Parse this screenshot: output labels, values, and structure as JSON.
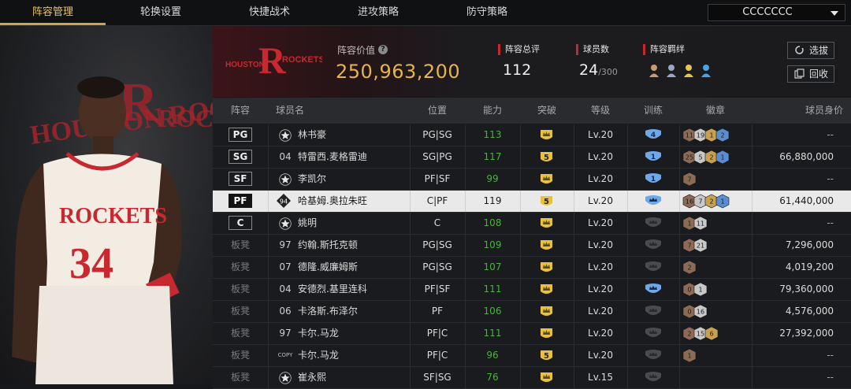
{
  "nav": {
    "tabs": [
      "阵容管理",
      "轮换设置",
      "快捷战术",
      "进攻策略",
      "防守策略"
    ],
    "team_select": "CCCCCCC"
  },
  "header": {
    "logo_text_left": "HOUSTON",
    "logo_text_right": "ROCKETS",
    "lineup_value_label": "阵容价值",
    "lineup_value": "250,963,200",
    "total_rating_label": "阵容总评",
    "total_rating": "112",
    "player_count_label": "球员数",
    "player_count": "24",
    "player_count_max": "/300",
    "bond_label": "阵容羁绊",
    "select_button": "选拔",
    "recycle_button": "回收"
  },
  "table": {
    "headers": [
      "阵容",
      "球员名",
      "位置",
      "能力",
      "突破",
      "等级",
      "训练",
      "徽章",
      "球员身价"
    ],
    "rows": [
      {
        "slot": "PG",
        "num": "",
        "name": "林书豪",
        "pos": "PG|SG",
        "ability": "113",
        "break": "",
        "level": "Lv.20",
        "train": "4",
        "badges": [
          "11",
          "19",
          "1",
          "2"
        ],
        "value": "--"
      },
      {
        "slot": "SG",
        "num": "04",
        "name": "特雷西.麦格雷迪",
        "pos": "SG|PG",
        "ability": "117",
        "break": "5",
        "level": "Lv.20",
        "train": "1",
        "badges": [
          "25",
          "5",
          "2",
          "1"
        ],
        "value": "66,880,000"
      },
      {
        "slot": "SF",
        "num": "",
        "name": "李凯尔",
        "pos": "PF|SF",
        "ability": "99",
        "break": "",
        "level": "Lv.20",
        "train": "1",
        "badges": [
          "7"
        ],
        "value": "--"
      },
      {
        "slot": "PF",
        "num": "94",
        "name": "哈基姆.奥拉朱旺",
        "pos": "C|PF",
        "ability": "119",
        "break": "5",
        "level": "Lv.20",
        "train": "",
        "badges": [
          "16",
          "7",
          "2",
          "1"
        ],
        "value": "61,440,000"
      },
      {
        "slot": "C",
        "num": "",
        "name": "姚明",
        "pos": "C",
        "ability": "108",
        "break": "",
        "level": "Lv.20",
        "train": "",
        "badges": [
          "1",
          "11"
        ],
        "value": "--"
      },
      {
        "slot": "板凳",
        "num": "97",
        "name": "约翰.斯托克顿",
        "pos": "PG|SG",
        "ability": "109",
        "break": "",
        "level": "Lv.20",
        "train": "",
        "badges": [
          "7",
          "21"
        ],
        "value": "7,296,000"
      },
      {
        "slot": "板凳",
        "num": "07",
        "name": "德隆.威廉姆斯",
        "pos": "PG|SG",
        "ability": "107",
        "break": "",
        "level": "Lv.20",
        "train": "",
        "badges": [
          "2"
        ],
        "value": "4,019,200"
      },
      {
        "slot": "板凳",
        "num": "04",
        "name": "安德烈.基里连科",
        "pos": "PF|SF",
        "ability": "111",
        "break": "",
        "level": "Lv.20",
        "train": "",
        "badges": [
          "0",
          "1"
        ],
        "value": "79,360,000"
      },
      {
        "slot": "板凳",
        "num": "06",
        "name": "卡洛斯.布泽尔",
        "pos": "PF",
        "ability": "106",
        "break": "",
        "level": "Lv.20",
        "train": "",
        "badges": [
          "0",
          "16"
        ],
        "value": "4,576,000"
      },
      {
        "slot": "板凳",
        "num": "97",
        "name": "卡尔.马龙",
        "pos": "PF|C",
        "ability": "111",
        "break": "",
        "level": "Lv.20",
        "train": "",
        "badges": [
          "2",
          "15",
          "6"
        ],
        "value": "27,392,000"
      },
      {
        "slot": "板凳",
        "num": "COPY",
        "name": "卡尔.马龙",
        "pos": "PF|C",
        "ability": "96",
        "break": "5",
        "level": "Lv.20",
        "train": "",
        "badges": [
          "1"
        ],
        "value": "--"
      },
      {
        "slot": "板凳",
        "num": "",
        "name": "崔永熙",
        "pos": "SF|SG",
        "ability": "76",
        "break": "",
        "level": "Lv.15",
        "train": "",
        "badges": [],
        "value": "--"
      }
    ]
  },
  "player_art": {
    "jersey_team": "ROCKETS",
    "jersey_number": "34",
    "bg_text": "HOUSTON ROCKETS"
  },
  "colors": {
    "accent_gold": "#e5b44c",
    "brand_red": "#c7282f",
    "ability_green": "#49b43c"
  }
}
